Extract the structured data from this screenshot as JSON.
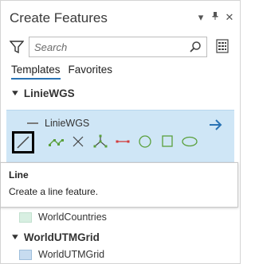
{
  "panel": {
    "title": "Create Features",
    "title_icons": [
      "chevron-down-icon",
      "pin-icon",
      "close-icon"
    ]
  },
  "search": {
    "placeholder": "Search"
  },
  "tabs": [
    {
      "label": "Templates",
      "active": true
    },
    {
      "label": "Favorites",
      "active": false
    }
  ],
  "groups": [
    {
      "name": "LinieWGS",
      "templates": [
        {
          "label": "LinieWGS",
          "swatch": "#7a7a7a"
        }
      ]
    },
    {
      "name": "WorldUTMGrid",
      "templates": [
        {
          "label": "WorldUTMGrid",
          "swatch": "#c7dcf0"
        }
      ]
    }
  ],
  "other_templates": [
    {
      "label": "WorldCountries",
      "swatch": "#d8efe2"
    }
  ],
  "tools": [
    {
      "name": "line",
      "icon": "line-icon",
      "selected": true
    },
    {
      "name": "right-angle-line",
      "icon": "right-angle-line-icon"
    },
    {
      "name": "direction-distance",
      "icon": "x-icon"
    },
    {
      "name": "trace",
      "icon": "trace-icon"
    },
    {
      "name": "two-point-line",
      "icon": "two-point-line-icon"
    },
    {
      "name": "circle",
      "icon": "circle-icon"
    },
    {
      "name": "rectangle",
      "icon": "rectangle-icon"
    },
    {
      "name": "ellipse",
      "icon": "ellipse-icon"
    }
  ],
  "tooltip": {
    "title": "Line",
    "description": "Create a line feature."
  },
  "colors": {
    "selected_bg": "#cfe6f6",
    "accent": "#2a73b4",
    "tool_green": "#5aa03c",
    "tool_red": "#d23c3c",
    "tool_dark": "#444444"
  }
}
